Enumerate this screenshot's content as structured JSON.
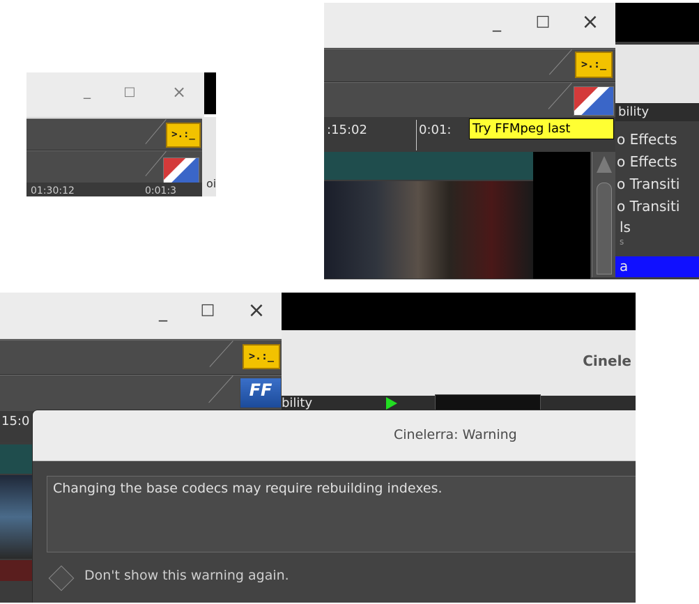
{
  "window_controls": {
    "minimize": "_",
    "maximize": "□",
    "close": "×"
  },
  "panel1": {
    "timecode": "01:30:12",
    "timecode2": "0:01:3",
    "side_text": "oi"
  },
  "panel2": {
    "timecode": ":15:02",
    "timecode2": "0:01:",
    "tooltip": "Try FFMpeg last",
    "tab_label": "bility",
    "resources": [
      "o Effects",
      "o Effects",
      "o Transiti",
      "o Transiti",
      "ls",
      "s",
      "a"
    ]
  },
  "panel3": {
    "title_partial": "Cinele",
    "tab_label": "bility",
    "timecode": "15:0",
    "dialog": {
      "title": "Cinelerra: Warning",
      "message": "Changing the base codecs may require rebuilding indexes.",
      "checkbox_label": "Don't show this warning again."
    }
  },
  "icons": {
    "terminal": ">.:_",
    "ffmpeg": "FF"
  },
  "colors": {
    "titlebar": "#ececec",
    "dark_bar": "#4b4b4b",
    "tooltip_bg": "#ffff33",
    "selected_blue": "#1010ff",
    "track_teal": "#1f4d4d",
    "dialog_bg": "#434343"
  }
}
